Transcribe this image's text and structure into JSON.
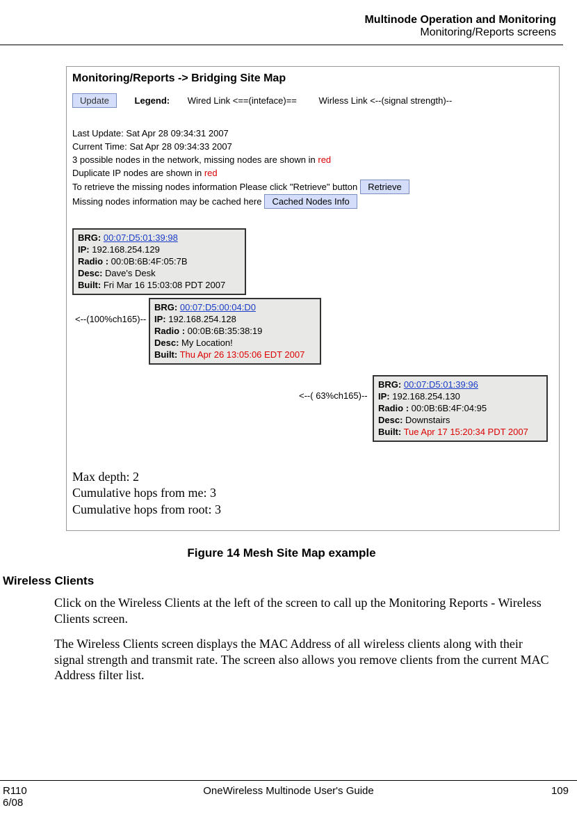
{
  "header": {
    "title": "Multinode Operation and Monitoring",
    "subtitle": "Monitoring/Reports screens"
  },
  "screenshot": {
    "breadcrumb": "Monitoring/Reports -> Bridging Site Map",
    "update_btn": "Update",
    "legend_label": "Legend:",
    "legend_wired": "Wired Link <==(inteface)==",
    "legend_wireless": "Wirless Link <--(signal strength)--",
    "last_update": "Last Update: Sat Apr 28 09:34:31 2007",
    "current_time": "Current Time: Sat Apr 28 09:34:33 2007",
    "possible_nodes_prefix": "3 possible nodes in the network, missing nodes are shown in ",
    "red1": "red",
    "dup_ip_prefix": "Duplicate IP nodes are shown in ",
    "red2": "red",
    "retrieve_line": "To retrieve the missing nodes information Please click \"Retrieve\" button",
    "retrieve_btn": "Retrieve",
    "cached_line": "Missing nodes information may be cached here",
    "cached_btn": "Cached Nodes Info",
    "node1": {
      "brg_lbl": "BRG:",
      "brg": "00:07:D5:01:39:98",
      "ip_lbl": "IP:",
      "ip": " 192.168.254.129",
      "radio_lbl": "Radio :",
      "radio": " 00:0B:6B:4F:05:7B",
      "desc_lbl": "Desc:",
      "desc": " Dave's Desk",
      "built_lbl": "Built:",
      "built": "  Fri Mar 16 15:03:08 PDT 2007"
    },
    "signal1": "<--(100%ch165)--",
    "node2": {
      "brg_lbl": "BRG:",
      "brg": "00:07:D5:00:04:D0",
      "ip_lbl": "IP:",
      "ip": " 192.168.254.128",
      "radio_lbl": "Radio :",
      "radio": " 00:0B:6B:35:38:19",
      "desc_lbl": "Desc:",
      "desc": " My Location!",
      "built_lbl": "Built:",
      "built": " Thu Apr 26 13:05:06 EDT 2007"
    },
    "signal2": "<--( 63%ch165)--",
    "node3": {
      "brg_lbl": "BRG:",
      "brg": "00:07:D5:01:39:96",
      "ip_lbl": "IP:",
      "ip": " 192.168.254.130",
      "radio_lbl": "Radio :",
      "radio": " 00:0B:6B:4F:04:95",
      "desc_lbl": "Desc:",
      "desc": " Downstairs",
      "built_lbl": "Built:",
      "built": " Tue Apr 17 15:20:34 PDT 2007"
    },
    "summary": {
      "max_depth": "Max depth: 2",
      "hops_me": "Cumulative hops from me: 3",
      "hops_root": "Cumulative hops from root: 3"
    }
  },
  "figure_caption": "Figure 14  Mesh Site Map example",
  "section_heading": "Wireless Clients",
  "para1": "Click on the Wireless Clients at the left of the screen to call up the Monitoring Reports - Wireless Clients screen.",
  "para2": "The Wireless Clients screen displays the MAC Address of all wireless clients along with their signal strength and transmit rate.  The screen also allows you remove clients from the current MAC Address filter list.",
  "footer": {
    "left1": "R110",
    "left2": "6/08",
    "center": "OneWireless Multinode User's Guide",
    "right": "109"
  }
}
